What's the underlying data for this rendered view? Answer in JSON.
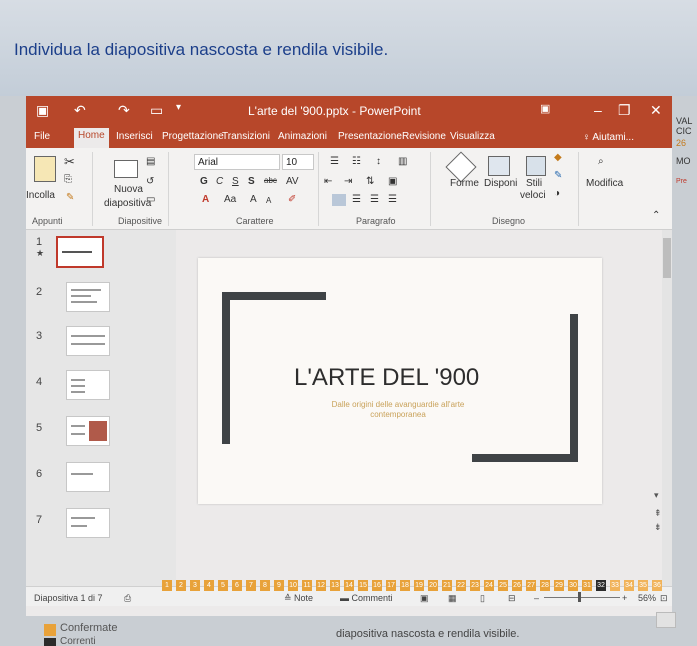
{
  "instruction": "Individua la diapositiva nascosta e rendila visibile.",
  "window": {
    "title": "L'arte del '900.pptx - PowerPoint"
  },
  "tabs": [
    "File",
    "Home",
    "Inserisci",
    "Progettazione",
    "Transizioni",
    "Animazioni",
    "Presentazione",
    "Revisione",
    "Visualizza"
  ],
  "active_tab": "Home",
  "help_label": "Aiutami...",
  "ribbon": {
    "paste": "Incolla",
    "new_slide_1": "Nuova",
    "new_slide_2": "diapositiva",
    "font_name": "Arial",
    "font_size": "10",
    "bold": "G",
    "italic": "C",
    "underline": "S",
    "strike": "S",
    "abc": "abc",
    "spacing": "AV",
    "case": "Aa",
    "grow": "A",
    "shrink": "A",
    "shapes": "Forme",
    "arrange": "Disponi",
    "quick_styles_1": "Stili",
    "quick_styles_2": "veloci",
    "edit": "Modifica",
    "groups": {
      "clipboard": "Appunti",
      "slides": "Diapositive",
      "font": "Carattere",
      "paragraph": "Paragrafo",
      "drawing": "Disegno"
    }
  },
  "thumbnails": [
    "1",
    "2",
    "3",
    "4",
    "5",
    "6",
    "7"
  ],
  "slide": {
    "title": "L'ARTE DEL '900",
    "subtitle_1": "Dalle origini delle avanguardie all'arte",
    "subtitle_2": "contemporanea"
  },
  "status": {
    "slide_count": "Diapositiva 1 di 7",
    "notes": "Note",
    "comments": "Commenti",
    "zoom": "56%"
  },
  "legend": {
    "confirmed": "Confermate",
    "current": "Correnti"
  },
  "progress": {
    "cells": [
      "1",
      "2",
      "3",
      "4",
      "5",
      "6",
      "7",
      "8",
      "9",
      "10",
      "11",
      "12",
      "13",
      "14",
      "15",
      "16",
      "17",
      "18",
      "19",
      "20",
      "21",
      "22",
      "23",
      "24",
      "25",
      "26",
      "27",
      "28",
      "29",
      "30",
      "31",
      "32",
      "33",
      "34",
      "35",
      "36"
    ],
    "current": "32"
  },
  "footer_text": "diapositiva nascosta e rendila visibile.",
  "edge": {
    "a": "VAL",
    "b": "CIC",
    "c": "26",
    "d": "MO",
    "e": "Pre"
  },
  "colors": {
    "accent": "#b7472a",
    "progress": "#e8a23a",
    "current": "#2b2b2b",
    "instruction": "#1c3f8a"
  }
}
